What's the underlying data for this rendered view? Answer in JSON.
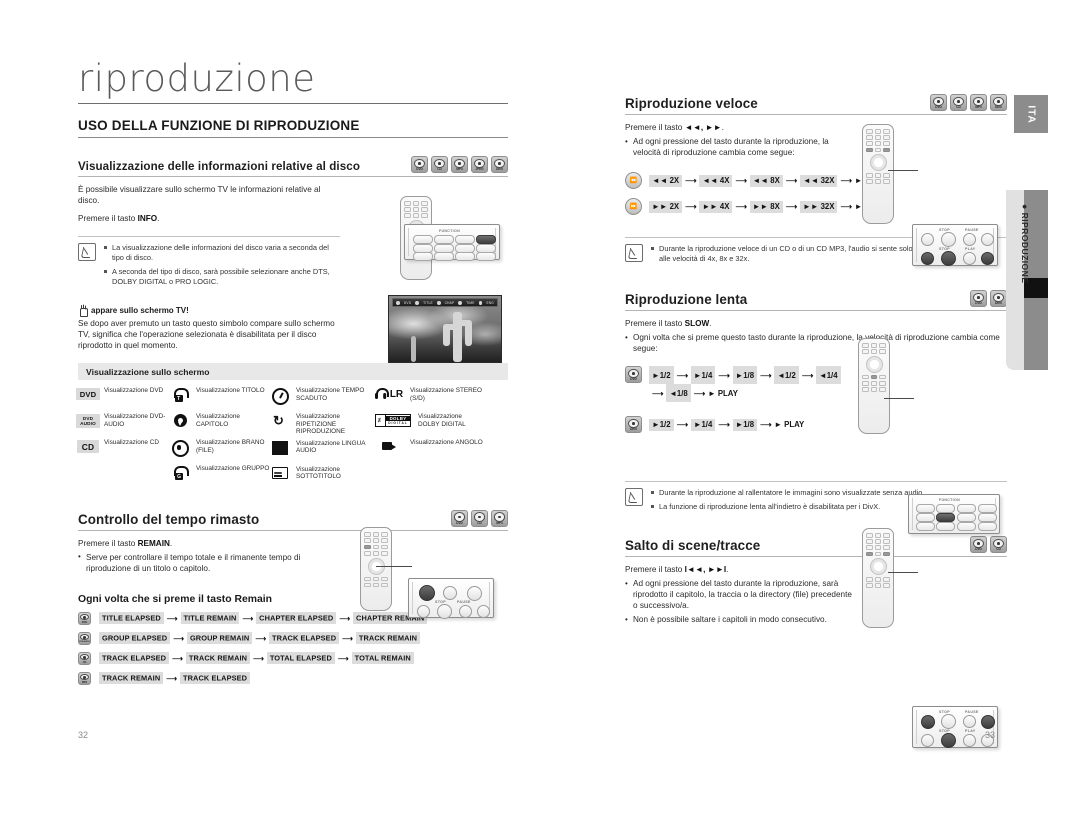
{
  "document": {
    "chapter_title": "riproduzione",
    "section_title": "USO DELLA FUNZIONE DI RIPRODUZIONE",
    "language_tab": "ITA",
    "side_tab_label": "RIPRODUZIONE",
    "page_left": "32",
    "page_right": "33"
  },
  "disc_badges": {
    "dvd": "DVD",
    "cd": "CD",
    "mp3": "MP3",
    "jpeg": "JPEG",
    "divx": "DivX",
    "dvd_audio": "DVD-AUDIO"
  },
  "left": {
    "disc_info": {
      "heading": "Visualizzazione delle informazioni relative al disco",
      "badges": [
        "DVD",
        "CD",
        "MP3",
        "JPEG",
        "DivX"
      ],
      "intro": "È possibile visualizzare sullo schermo TV le informazioni relative al disco.",
      "press_prefix": "Premere il tasto ",
      "press_key": "INFO",
      "press_suffix": ".",
      "notes": [
        "La visualizzazione delle informazioni del disco varia a seconda del tipo di disco.",
        "A seconda del tipo di disco, sarà possibile selezionare anche DTS, DOLBY DIGITAL o PRO LOGIC."
      ]
    },
    "tv_note": {
      "heading": "appare sullo schermo TV!",
      "body": "Se dopo aver premuto un tasto questo simbolo compare sullo schermo TV, significa che l'operazione selezionata è disabilitata per il disco riprodotto in quel momento."
    },
    "osd_table": {
      "title": "Visualizzazione sullo schermo",
      "columns": [
        [
          {
            "icon": "dvd-tag",
            "tag": "DVD",
            "label": "Visualizzazione DVD"
          },
          {
            "icon": "dvd-audio-tag",
            "tag": "DVD AUDIO",
            "label": "Visualizzazione DVD-AUDIO"
          },
          {
            "icon": "cd-tag",
            "tag": "CD",
            "label": "Visualizzazione CD"
          }
        ],
        [
          {
            "icon": "title-icon",
            "label": "Visualizzazione TITOLO"
          },
          {
            "icon": "chapter-icon",
            "label": "Visualizzazione CAPITOLO"
          },
          {
            "icon": "track-icon",
            "label": "Visualizzazione BRANO (FILE)"
          },
          {
            "icon": "group-icon",
            "label": "Visualizzazione GRUPPO"
          }
        ],
        [
          {
            "icon": "clock-icon",
            "label": "Visualizzazione TEMPO SCADUTO"
          },
          {
            "icon": "repeat-icon",
            "label": "Visualizzazione RIPETIZIONE RIPRODUZIONE"
          },
          {
            "icon": "audio-language-icon",
            "label": "Visualizzazione LINGUA AUDIO"
          },
          {
            "icon": "subtitle-icon",
            "label": "Visualizzazione SOTTOTITOLO"
          }
        ],
        [
          {
            "icon": "headphone-lr-icon",
            "tag": "LR",
            "label": "Visualizzazione STEREO (S/D)"
          },
          {
            "icon": "dolby-digital-icon",
            "label": "Visualizzazione DOLBY DIGITAL"
          },
          {
            "icon": "camera-angle-icon",
            "label": "Visualizzazione ANGOLO"
          }
        ]
      ]
    },
    "remain": {
      "heading": "Controllo del tempo rimasto",
      "badges": [
        "DVD",
        "CD",
        "MP3"
      ],
      "press_prefix": "Premere il tasto ",
      "press_key": "REMAIN",
      "press_suffix": ".",
      "bullet": "Serve per controllare il tempo totale e il rimanente tempo di riproduzione di un titolo o capitolo.",
      "callout_captions": [
        "STOP",
        "PAUSE"
      ],
      "callout_button_label": "REMAIN"
    },
    "remain_sequences": {
      "heading": "Ogni volta che si preme il tasto Remain",
      "rows": [
        {
          "badge": "DVD",
          "steps": [
            "TITLE ELAPSED",
            "TITLE REMAIN",
            "CHAPTER ELAPSED",
            "CHAPTER REMAIN"
          ]
        },
        {
          "badge": "DVD-AUDIO",
          "steps": [
            "GROUP ELAPSED",
            "GROUP REMAIN",
            "TRACK ELAPSED",
            "TRACK REMAIN"
          ]
        },
        {
          "badge": "CD",
          "steps": [
            "TRACK ELAPSED",
            "TRACK REMAIN",
            "TOTAL ELAPSED",
            "TOTAL REMAIN"
          ]
        },
        {
          "badge": "MP3",
          "steps": [
            "TRACK REMAIN",
            "TRACK ELAPSED"
          ]
        }
      ]
    }
  },
  "right": {
    "fast": {
      "heading": "Riproduzione veloce",
      "badges": [
        "DVD",
        "CD",
        "MP3",
        "DivX"
      ],
      "press_prefix": "Premere il tasto ",
      "press_key": "◄◄, ►►",
      "press_suffix": ".",
      "bullet": "Ad ogni pressione del tasto durante la riproduzione, la velocità di riproduzione cambia come segue:",
      "sequences": [
        {
          "key": "rewind",
          "steps": [
            "◄◄ 2X",
            "◄◄ 4X",
            "◄◄ 8X",
            "◄◄ 32X",
            "► PLAY"
          ]
        },
        {
          "key": "forward",
          "steps": [
            "►► 2X",
            "►► 4X",
            "►► 8X",
            "►► 32X",
            "► PLAY"
          ]
        }
      ],
      "notes": [
        "Durante la riproduzione veloce di un CD o di un CD MP3, l'audio si sente solo alla velocità di 2x, e non alle velocità di 4x, 8x e 32x."
      ],
      "callout_captions": [
        "STOP",
        "PAUSE",
        "STOP",
        "PLAY"
      ]
    },
    "slow": {
      "heading": "Riproduzione lenta",
      "badges": [
        "DVD",
        "DivX"
      ],
      "press_prefix": "Premere il tasto ",
      "press_key": "SLOW",
      "press_suffix": ".",
      "bullet": "Ogni volta che si preme questo tasto durante la riproduzione, la velocità di riproduzione cambia come segue:",
      "sequences": [
        {
          "badge": "DVD",
          "steps": [
            "►1/2",
            "►1/4",
            "►1/8",
            "◄1/2",
            "◄1/4",
            "◄1/8",
            "► PLAY"
          ]
        },
        {
          "badge": "DivX",
          "steps": [
            "►1/2",
            "►1/4",
            "►1/8",
            "► PLAY"
          ]
        }
      ],
      "notes": [
        "Durante la riproduzione al rallentatore le immagini sono visualizzate senza audio.",
        "La funzione di riproduzione lenta all'indietro è disabilitata per i DivX."
      ]
    },
    "skip": {
      "heading": "Salto di scene/tracce",
      "badges": [
        "DVD",
        "CD"
      ],
      "press_prefix": "Premere il tasto ",
      "press_key": "I◄◄, ►►I",
      "press_suffix": ".",
      "bullets": [
        "Ad ogni pressione del tasto durante la riproduzione, sarà riprodotto il capitolo, la traccia o la directory (file) precedente o successivo/a.",
        "Non è possibile saltare i capitoli in modo consecutivo."
      ],
      "callout_captions": [
        "STOP",
        "PAUSE",
        "STOP",
        "PLAY"
      ]
    }
  },
  "osd_overlay": {
    "items": [
      "DVD",
      "1/5",
      "TITLE",
      "01/12",
      "CHAP",
      "00:12:34",
      "TIME",
      "ENG"
    ]
  }
}
